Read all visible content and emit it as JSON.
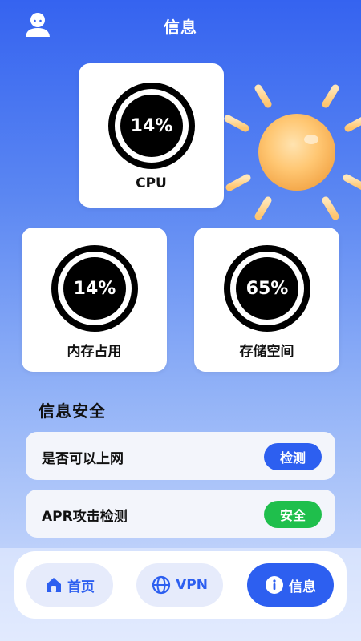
{
  "header": {
    "title": "信息",
    "user_icon": "user-icon"
  },
  "stats": {
    "cpu": {
      "value": "14%",
      "label": "CPU"
    },
    "memory": {
      "value": "14%",
      "label": "内存占用"
    },
    "storage": {
      "value": "65%",
      "label": "存储空间"
    }
  },
  "security": {
    "title": "信息安全",
    "items": [
      {
        "label": "是否可以上网",
        "action": "检测",
        "color": "#2d5ff0"
      },
      {
        "label": "APR攻击检测",
        "action": "安全",
        "color": "#1fbf4c"
      }
    ]
  },
  "nav": {
    "items": [
      {
        "label": "首页",
        "icon": "home-icon"
      },
      {
        "label": "VPN",
        "icon": "globe-icon"
      },
      {
        "label": "信息",
        "icon": "info-icon",
        "active": true
      }
    ]
  },
  "colors": {
    "accent": "#2d5ff0",
    "safe": "#1fbf4c",
    "nav_inactive_bg": "#e6ebfb"
  }
}
